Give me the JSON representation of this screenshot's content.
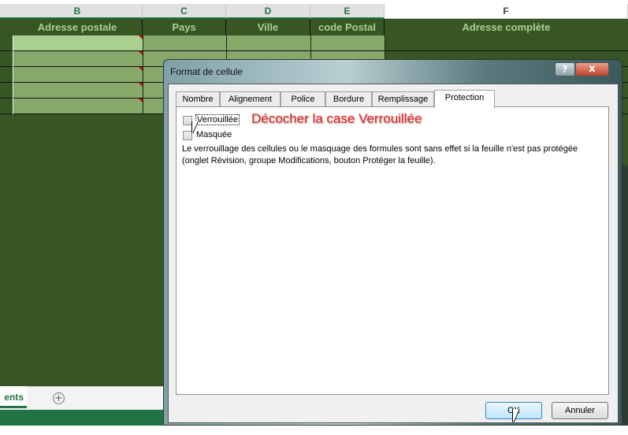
{
  "columns": [
    "B",
    "C",
    "D",
    "E",
    "F"
  ],
  "headers": [
    "Adresse postale",
    "Pays",
    "Ville",
    "code Postal",
    "Adresse complète"
  ],
  "sheet_tab": "ents",
  "dialog": {
    "title": "Format de cellule",
    "help": "?",
    "close": "x",
    "tabs": [
      "Nombre",
      "Alignement",
      "Police",
      "Bordure",
      "Remplissage",
      "Protection"
    ],
    "active_tab": "Protection",
    "checkboxes": [
      {
        "label": "Verrouillée",
        "checked": false
      },
      {
        "label": "Masquée",
        "checked": false
      }
    ],
    "annotation": "Décocher la case Verrouillée",
    "info_line1": "Le verrouillage des cellules ou le masquage des formules sont sans effet si la feuille n'est pas protégée",
    "info_line2": "(onglet Révision, groupe Modifications, bouton Protéger la feuille).",
    "ok": "OK",
    "cancel": "Annuler"
  },
  "colors": {
    "excel_green": "#217346",
    "header_bg": "#375623",
    "annotation": "#e8201a"
  }
}
